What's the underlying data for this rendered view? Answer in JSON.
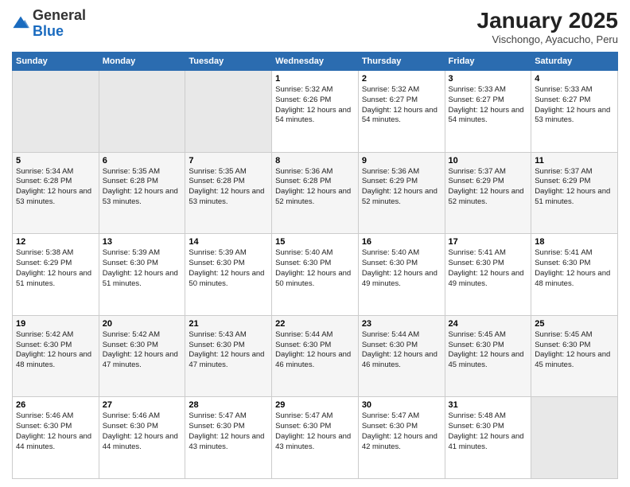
{
  "logo": {
    "general": "General",
    "blue": "Blue"
  },
  "header": {
    "month_title": "January 2025",
    "location": "Vischongo, Ayacucho, Peru"
  },
  "weekdays": [
    "Sunday",
    "Monday",
    "Tuesday",
    "Wednesday",
    "Thursday",
    "Friday",
    "Saturday"
  ],
  "weeks": [
    [
      {
        "day": "",
        "empty": true
      },
      {
        "day": "",
        "empty": true
      },
      {
        "day": "",
        "empty": true
      },
      {
        "day": "1",
        "sunrise": "5:32 AM",
        "sunset": "6:26 PM",
        "daylight": "12 hours and 54 minutes."
      },
      {
        "day": "2",
        "sunrise": "5:32 AM",
        "sunset": "6:27 PM",
        "daylight": "12 hours and 54 minutes."
      },
      {
        "day": "3",
        "sunrise": "5:33 AM",
        "sunset": "6:27 PM",
        "daylight": "12 hours and 54 minutes."
      },
      {
        "day": "4",
        "sunrise": "5:33 AM",
        "sunset": "6:27 PM",
        "daylight": "12 hours and 53 minutes."
      }
    ],
    [
      {
        "day": "5",
        "sunrise": "5:34 AM",
        "sunset": "6:28 PM",
        "daylight": "12 hours and 53 minutes."
      },
      {
        "day": "6",
        "sunrise": "5:35 AM",
        "sunset": "6:28 PM",
        "daylight": "12 hours and 53 minutes."
      },
      {
        "day": "7",
        "sunrise": "5:35 AM",
        "sunset": "6:28 PM",
        "daylight": "12 hours and 53 minutes."
      },
      {
        "day": "8",
        "sunrise": "5:36 AM",
        "sunset": "6:28 PM",
        "daylight": "12 hours and 52 minutes."
      },
      {
        "day": "9",
        "sunrise": "5:36 AM",
        "sunset": "6:29 PM",
        "daylight": "12 hours and 52 minutes."
      },
      {
        "day": "10",
        "sunrise": "5:37 AM",
        "sunset": "6:29 PM",
        "daylight": "12 hours and 52 minutes."
      },
      {
        "day": "11",
        "sunrise": "5:37 AM",
        "sunset": "6:29 PM",
        "daylight": "12 hours and 51 minutes."
      }
    ],
    [
      {
        "day": "12",
        "sunrise": "5:38 AM",
        "sunset": "6:29 PM",
        "daylight": "12 hours and 51 minutes."
      },
      {
        "day": "13",
        "sunrise": "5:39 AM",
        "sunset": "6:30 PM",
        "daylight": "12 hours and 51 minutes."
      },
      {
        "day": "14",
        "sunrise": "5:39 AM",
        "sunset": "6:30 PM",
        "daylight": "12 hours and 50 minutes."
      },
      {
        "day": "15",
        "sunrise": "5:40 AM",
        "sunset": "6:30 PM",
        "daylight": "12 hours and 50 minutes."
      },
      {
        "day": "16",
        "sunrise": "5:40 AM",
        "sunset": "6:30 PM",
        "daylight": "12 hours and 49 minutes."
      },
      {
        "day": "17",
        "sunrise": "5:41 AM",
        "sunset": "6:30 PM",
        "daylight": "12 hours and 49 minutes."
      },
      {
        "day": "18",
        "sunrise": "5:41 AM",
        "sunset": "6:30 PM",
        "daylight": "12 hours and 48 minutes."
      }
    ],
    [
      {
        "day": "19",
        "sunrise": "5:42 AM",
        "sunset": "6:30 PM",
        "daylight": "12 hours and 48 minutes."
      },
      {
        "day": "20",
        "sunrise": "5:42 AM",
        "sunset": "6:30 PM",
        "daylight": "12 hours and 47 minutes."
      },
      {
        "day": "21",
        "sunrise": "5:43 AM",
        "sunset": "6:30 PM",
        "daylight": "12 hours and 47 minutes."
      },
      {
        "day": "22",
        "sunrise": "5:44 AM",
        "sunset": "6:30 PM",
        "daylight": "12 hours and 46 minutes."
      },
      {
        "day": "23",
        "sunrise": "5:44 AM",
        "sunset": "6:30 PM",
        "daylight": "12 hours and 46 minutes."
      },
      {
        "day": "24",
        "sunrise": "5:45 AM",
        "sunset": "6:30 PM",
        "daylight": "12 hours and 45 minutes."
      },
      {
        "day": "25",
        "sunrise": "5:45 AM",
        "sunset": "6:30 PM",
        "daylight": "12 hours and 45 minutes."
      }
    ],
    [
      {
        "day": "26",
        "sunrise": "5:46 AM",
        "sunset": "6:30 PM",
        "daylight": "12 hours and 44 minutes."
      },
      {
        "day": "27",
        "sunrise": "5:46 AM",
        "sunset": "6:30 PM",
        "daylight": "12 hours and 44 minutes."
      },
      {
        "day": "28",
        "sunrise": "5:47 AM",
        "sunset": "6:30 PM",
        "daylight": "12 hours and 43 minutes."
      },
      {
        "day": "29",
        "sunrise": "5:47 AM",
        "sunset": "6:30 PM",
        "daylight": "12 hours and 43 minutes."
      },
      {
        "day": "30",
        "sunrise": "5:47 AM",
        "sunset": "6:30 PM",
        "daylight": "12 hours and 42 minutes."
      },
      {
        "day": "31",
        "sunrise": "5:48 AM",
        "sunset": "6:30 PM",
        "daylight": "12 hours and 41 minutes."
      },
      {
        "day": "",
        "empty": true
      }
    ]
  ],
  "labels": {
    "sunrise": "Sunrise:",
    "sunset": "Sunset:",
    "daylight": "Daylight:"
  }
}
